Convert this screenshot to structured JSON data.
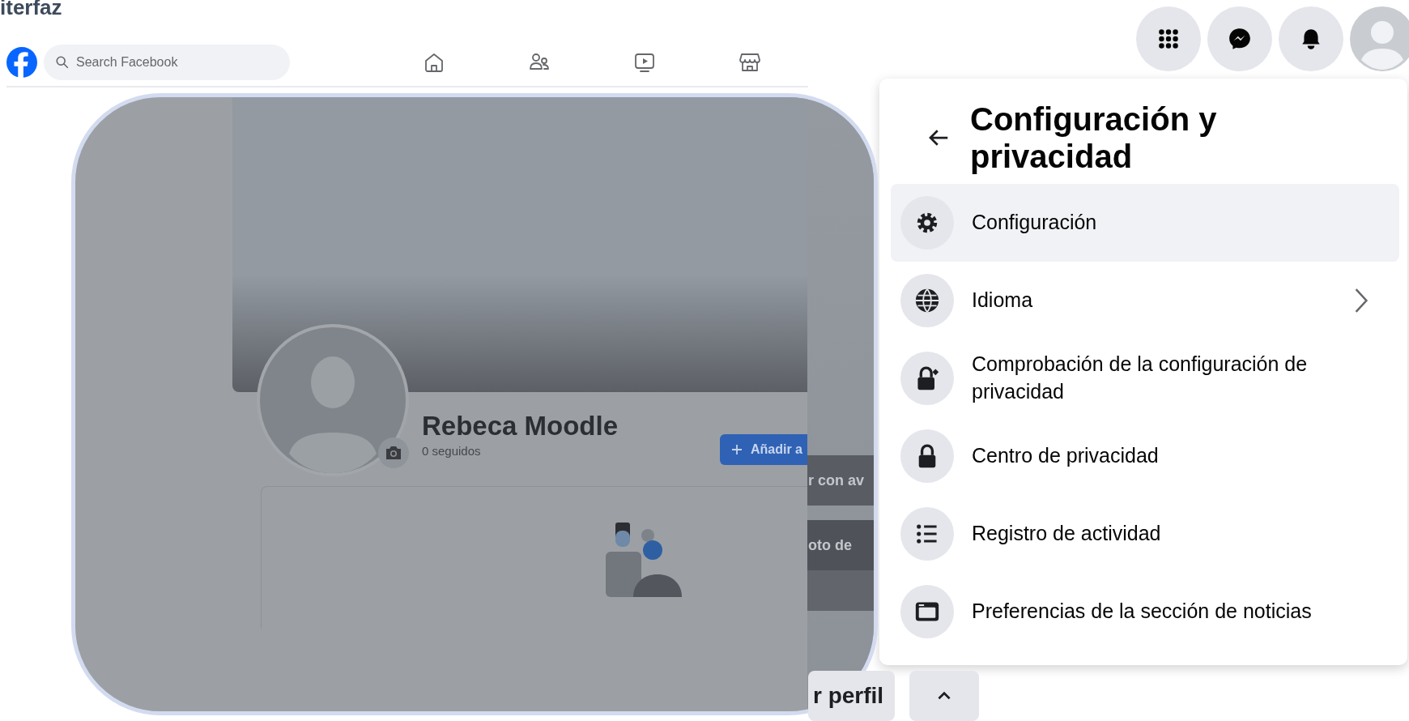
{
  "heading": {
    "text": "iterfaz"
  },
  "navbar": {
    "search": {
      "placeholder": "Search Facebook"
    }
  },
  "settings_menu": {
    "title": "Configuración y privacidad",
    "items": [
      {
        "label": "Configuración",
        "selected": true,
        "has_submenu": false
      },
      {
        "label": "Idioma",
        "selected": false,
        "has_submenu": true
      },
      {
        "label": "Comprobación de la configuración de privacidad",
        "selected": false,
        "has_submenu": false
      },
      {
        "label": "Centro de privacidad",
        "selected": false,
        "has_submenu": false
      },
      {
        "label": "Registro de actividad",
        "selected": false,
        "has_submenu": false
      },
      {
        "label": "Preferencias de la sección de noticias",
        "selected": false,
        "has_submenu": false
      }
    ]
  },
  "profile": {
    "name": "Rebeca Moodle",
    "following": "0 seguidos",
    "add_button": "Añadir a"
  },
  "background_page": {
    "buttons": [
      "r con av",
      "oto de"
    ],
    "bottom_buttons": [
      {
        "kind": "text",
        "label": "r perfil"
      },
      {
        "kind": "collapse"
      }
    ]
  }
}
